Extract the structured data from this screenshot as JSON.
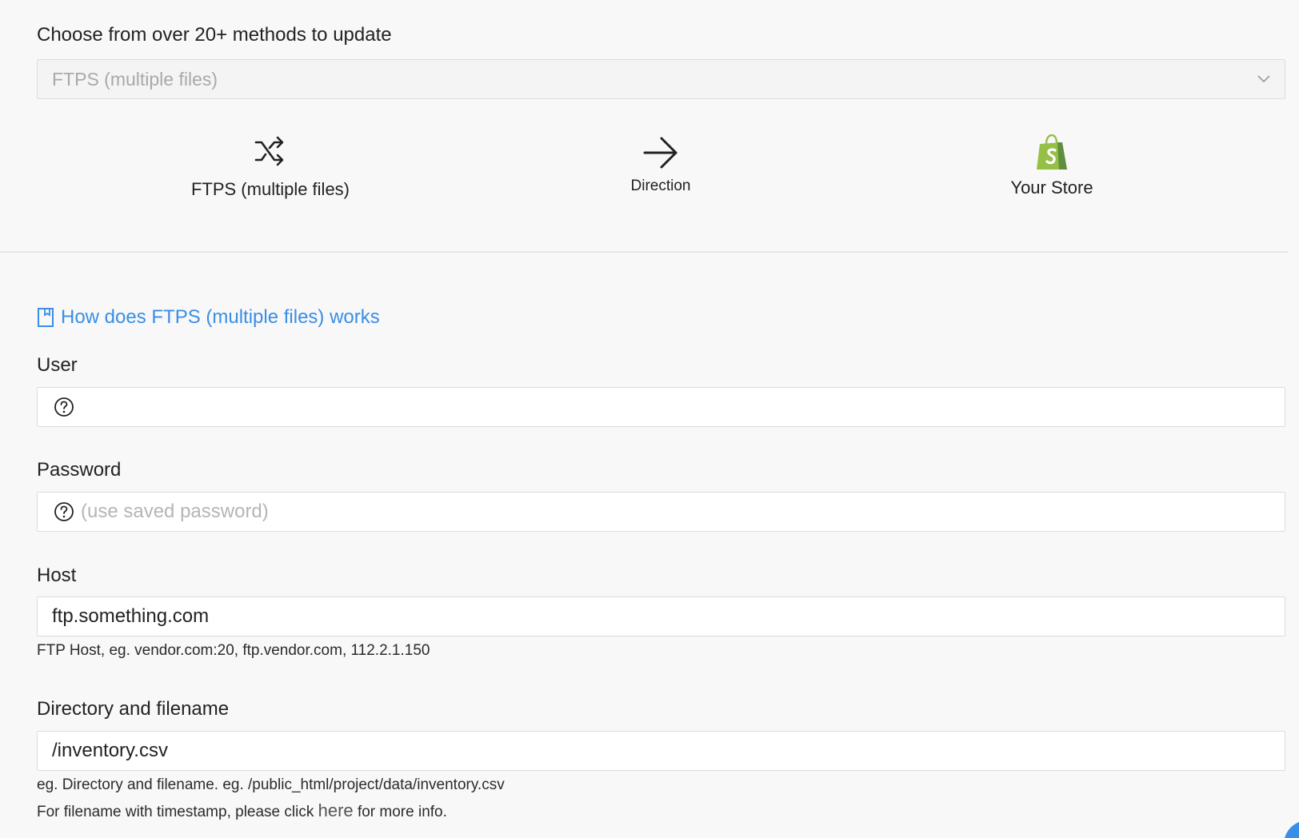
{
  "method_section": {
    "label": "Choose from over 20+ methods to update",
    "selected_method": "FTPS (multiple files)"
  },
  "flow": {
    "source_label": "FTPS (multiple files)",
    "source_icon": "shuffle-icon",
    "direction_label": "Direction",
    "direction_icon": "arrow-right-icon",
    "target_label": "Your Store",
    "target_icon": "shopify-bag-icon"
  },
  "help": {
    "link_text": "How does FTPS (multiple files) works",
    "icon": "book-icon"
  },
  "fields": {
    "user": {
      "label": "User",
      "value": "",
      "placeholder": ""
    },
    "password": {
      "label": "Password",
      "value": "",
      "placeholder": "(use saved password)"
    },
    "host": {
      "label": "Host",
      "value": "ftp.something.com",
      "hint": "FTP Host, eg. vendor.com:20, ftp.vendor.com, 112.2.1.150"
    },
    "directory": {
      "label": "Directory and filename",
      "value": "/inventory.csv",
      "hint": "eg. Directory and filename. eg. /public_html/project/data/inventory.csv",
      "timestamp_hint_before": "For filename with timestamp, please click ",
      "timestamp_hint_link": "here",
      "timestamp_hint_after": " for more info."
    }
  },
  "colors": {
    "accent": "#3a8ee6",
    "shopify_green": "#95bf47",
    "background": "#f8f8f8"
  }
}
